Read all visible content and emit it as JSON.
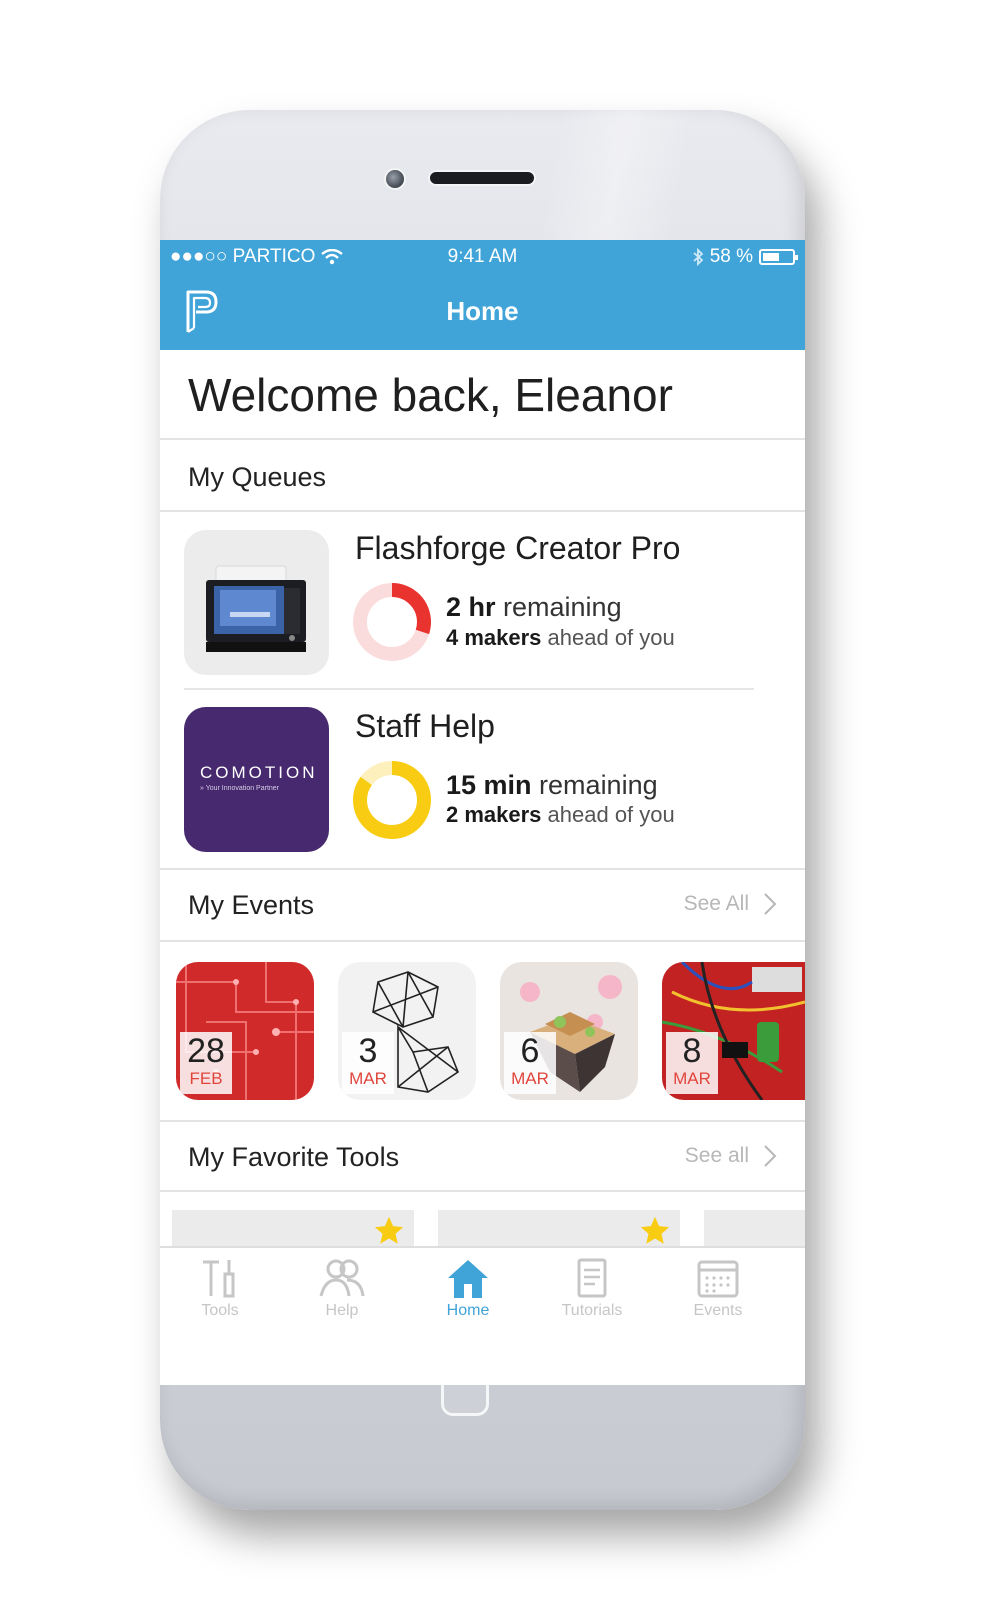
{
  "status_bar": {
    "carrier": "●●●○○ PARTICO",
    "time": "9:41 AM",
    "battery": "58 %",
    "battery_level": 0.58
  },
  "nav": {
    "title": "Home"
  },
  "welcome": "Welcome back, Eleanor",
  "queues": {
    "title": "My Queues",
    "items": [
      {
        "name": "Flashforge Creator Pro",
        "remaining_strong": "2 hr",
        "remaining_rest": " remaining",
        "ahead_strong": "4 makers",
        "ahead_rest": " ahead of you",
        "progress": 0.3,
        "ring_color": "#e8332f",
        "ring_track": "#fbdcdc"
      },
      {
        "name": "Staff Help",
        "remaining_strong": "15 min",
        "remaining_rest": " remaining",
        "ahead_strong": "2 makers",
        "ahead_rest": " ahead of you",
        "logo_text": "COMOTION",
        "logo_tagline": "» Your Innovation Partner",
        "progress": 0.85,
        "ring_color": "#f9cc14",
        "ring_track": "#fdf0bd"
      }
    ]
  },
  "events": {
    "title": "My Events",
    "see_all": "See All",
    "items": [
      {
        "day": "28",
        "month": "FEB"
      },
      {
        "day": "3",
        "month": "MAR"
      },
      {
        "day": "6",
        "month": "MAR"
      },
      {
        "day": "8",
        "month": "MAR"
      }
    ]
  },
  "tools": {
    "title": "My Favorite Tools",
    "see_all": "See all"
  },
  "tabs": [
    {
      "label": "Tools",
      "icon": "tools-icon"
    },
    {
      "label": "Help",
      "icon": "people-icon"
    },
    {
      "label": "Home",
      "icon": "home-icon",
      "active": true
    },
    {
      "label": "Tutorials",
      "icon": "tutorials-icon"
    },
    {
      "label": "Events",
      "icon": "calendar-icon"
    }
  ],
  "colors": {
    "accent": "#40a4d8",
    "star": "#f9cc14",
    "month": "#e0453c"
  }
}
